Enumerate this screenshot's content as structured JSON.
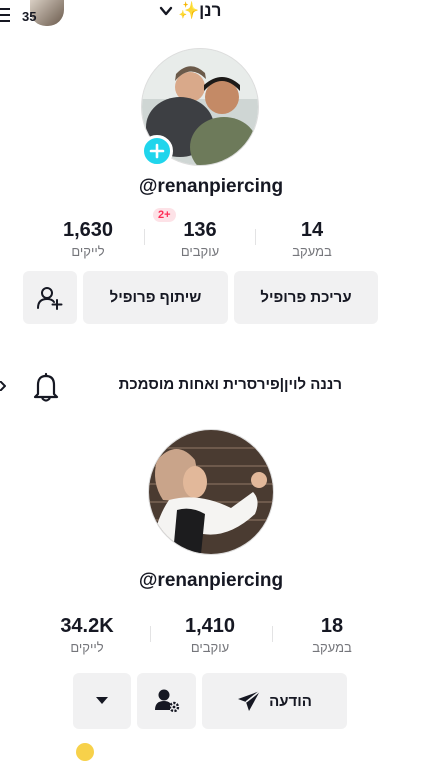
{
  "topbar": {
    "badge_count": "35",
    "title": "רנן✨",
    "chevron_icon": "chevron-down-icon",
    "menu_icon": "hamburger-menu-icon"
  },
  "profile1": {
    "username": "@renanpiercing",
    "add_icon": "plus-icon",
    "new_followers_badge": "2+",
    "stats": [
      {
        "value": "1,630",
        "label": "לייקים"
      },
      {
        "value": "136",
        "label": "עוקבים"
      },
      {
        "value": "14",
        "label": "במעקב"
      }
    ],
    "buttons": {
      "add_friend_icon": "add-user-icon",
      "share": "שיתוף פרופיל",
      "edit": "עריכת פרופיל"
    }
  },
  "section": {
    "title": "רננה לוין|פירסרית ואחות מוסמכת",
    "bell_icon": "bell-icon",
    "back_icon": "chevron-left-icon"
  },
  "profile2": {
    "username": "@renanpiercing",
    "stats": [
      {
        "value": "34.2K",
        "label": "לייקים"
      },
      {
        "value": "1,410",
        "label": "עוקבים"
      },
      {
        "value": "18",
        "label": "במעקב"
      }
    ],
    "buttons": {
      "more_icon": "caret-down-icon",
      "manage_icon": "user-settings-icon",
      "message": "הודעה",
      "message_icon": "send-icon"
    }
  }
}
